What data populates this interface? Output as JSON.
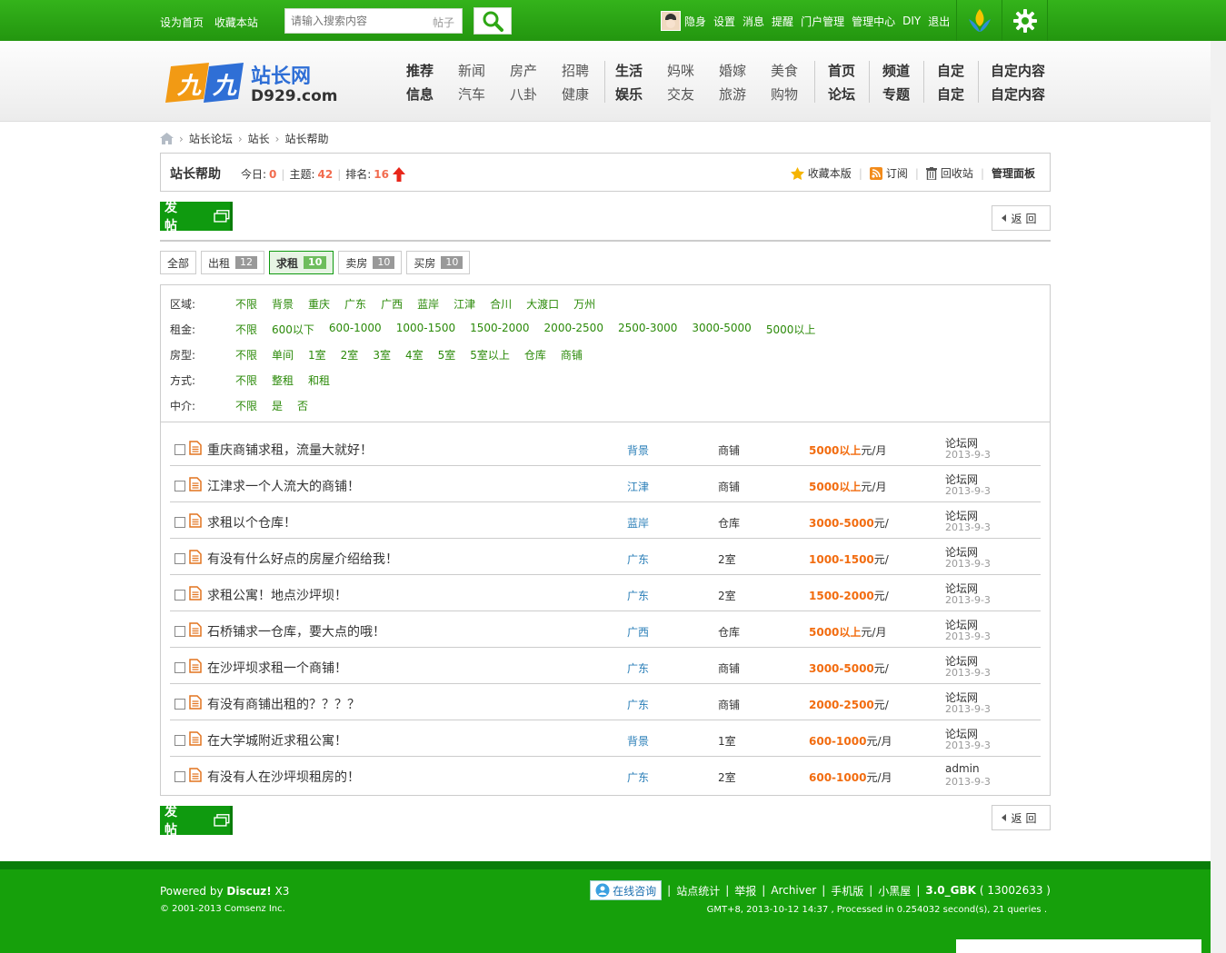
{
  "topbar": {
    "links": [
      "设为首页",
      "收藏本站"
    ],
    "search_placeholder": "请输入搜索内容",
    "search_scope": "帖子",
    "user_links": [
      "隐身",
      "设置",
      "消息",
      "提醒",
      "门户管理",
      "管理中心",
      "DIY",
      "退出"
    ]
  },
  "header": {
    "logo_text": "站长网",
    "logo_domain": "D929.com",
    "nav_groups": [
      {
        "top": [
          "推荐",
          "新闻",
          "房产",
          "招聘"
        ],
        "bottom": [
          "信息",
          "汽车",
          "八卦",
          "健康"
        ]
      },
      {
        "top": [
          "生活",
          "妈咪",
          "婚嫁",
          "美食"
        ],
        "bottom": [
          "娱乐",
          "交友",
          "旅游",
          "购物"
        ]
      },
      {
        "top": [
          "首页"
        ],
        "bottom": [
          "论坛"
        ]
      },
      {
        "top": [
          "频道"
        ],
        "bottom": [
          "专题"
        ]
      },
      {
        "top": [
          "自定"
        ],
        "bottom": [
          "自定"
        ]
      },
      {
        "top": [
          "自定内容"
        ],
        "bottom": [
          "自定内容"
        ]
      }
    ]
  },
  "breadcrumb": [
    "站长论坛",
    "站长",
    "站长帮助"
  ],
  "forum": {
    "title": "站长帮助",
    "today_label": "今日:",
    "today": "0",
    "topics_label": "主题:",
    "topics": "42",
    "rank_label": "排名:",
    "rank": "16",
    "actions": [
      "收藏本版",
      "订阅",
      "回收站",
      "管理面板"
    ]
  },
  "buttons": {
    "post": "发 帖",
    "back": "返回"
  },
  "tabs": [
    {
      "label": "全部",
      "count": ""
    },
    {
      "label": "出租",
      "count": "12"
    },
    {
      "label": "求租",
      "count": "10"
    },
    {
      "label": "卖房",
      "count": "10"
    },
    {
      "label": "买房",
      "count": "10"
    }
  ],
  "filters": [
    {
      "label": "区域:",
      "options": [
        "不限",
        "背景",
        "重庆",
        "广东",
        "广西",
        "蓝岸",
        "江津",
        "合川",
        "大渡口",
        "万州"
      ]
    },
    {
      "label": "租金:",
      "options": [
        "不限",
        "600以下",
        "600-1000",
        "1000-1500",
        "1500-2000",
        "2000-2500",
        "2500-3000",
        "3000-5000",
        "5000以上"
      ]
    },
    {
      "label": "房型:",
      "options": [
        "不限",
        "单间",
        "1室",
        "2室",
        "3室",
        "4室",
        "5室",
        "5室以上",
        "仓库",
        "商铺"
      ]
    },
    {
      "label": "方式:",
      "options": [
        "不限",
        "整租",
        "和租"
      ]
    },
    {
      "label": "中介:",
      "options": [
        "不限",
        "是",
        "否"
      ]
    }
  ],
  "threads": [
    {
      "subject": "重庆商铺求租，流量大就好！",
      "area": "背景",
      "type": "商铺",
      "rent": "5000以上",
      "unit": "元/月",
      "author": "论坛网",
      "date": "2013-9-3"
    },
    {
      "subject": "江津求一个人流大的商铺！",
      "area": "江津",
      "type": "商铺",
      "rent": "5000以上",
      "unit": "元/月",
      "author": "论坛网",
      "date": "2013-9-3"
    },
    {
      "subject": "求租以个仓库！",
      "area": "蓝岸",
      "type": "仓库",
      "rent": "3000-5000",
      "unit": "元/",
      "author": "论坛网",
      "date": "2013-9-3"
    },
    {
      "subject": "有没有什么好点的房屋介绍给我！",
      "area": "广东",
      "type": "2室",
      "rent": "1000-1500",
      "unit": "元/",
      "author": "论坛网",
      "date": "2013-9-3"
    },
    {
      "subject": "求租公寓！地点沙坪坝！",
      "area": "广东",
      "type": "2室",
      "rent": "1500-2000",
      "unit": "元/",
      "author": "论坛网",
      "date": "2013-9-3"
    },
    {
      "subject": "石桥铺求一仓库，要大点的哦！",
      "area": "广西",
      "type": "仓库",
      "rent": "5000以上",
      "unit": "元/月",
      "author": "论坛网",
      "date": "2013-9-3"
    },
    {
      "subject": "在沙坪坝求租一个商铺！",
      "area": "广东",
      "type": "商铺",
      "rent": "3000-5000",
      "unit": "元/",
      "author": "论坛网",
      "date": "2013-9-3"
    },
    {
      "subject": "有没有商铺出租的？？？？",
      "area": "广东",
      "type": "商铺",
      "rent": "2000-2500",
      "unit": "元/",
      "author": "论坛网",
      "date": "2013-9-3"
    },
    {
      "subject": "在大学城附近求租公寓！",
      "area": "背景",
      "type": "1室",
      "rent": "600-1000",
      "unit": "元/月",
      "author": "论坛网",
      "date": "2013-9-3"
    },
    {
      "subject": "有没有人在沙坪坝租房的！",
      "area": "广东",
      "type": "2室",
      "rent": "600-1000",
      "unit": "元/月",
      "author": "admin",
      "date": "2013-9-3"
    }
  ],
  "footer": {
    "powered_prefix": "Powered by ",
    "powered_brand": "Discuz!",
    "powered_version": " X3",
    "copyright": "© 2001-2013 Comsenz Inc.",
    "online_consult": "在线咨询",
    "links": [
      "站点统计",
      "举报",
      "Archiver",
      "手机版",
      "小黑屋"
    ],
    "version": "3.0_GBK",
    "site_id": "( 13002633 )",
    "gmt": "GMT+8, 2013-10-12 14:37 , Processed in 0.254032 second(s), 21 queries ."
  },
  "colors": {
    "brand_green": "#16a00b",
    "link_green": "#2b8a09",
    "rent_orange": "#f26c0f",
    "area_blue": "#2b7fb8"
  }
}
